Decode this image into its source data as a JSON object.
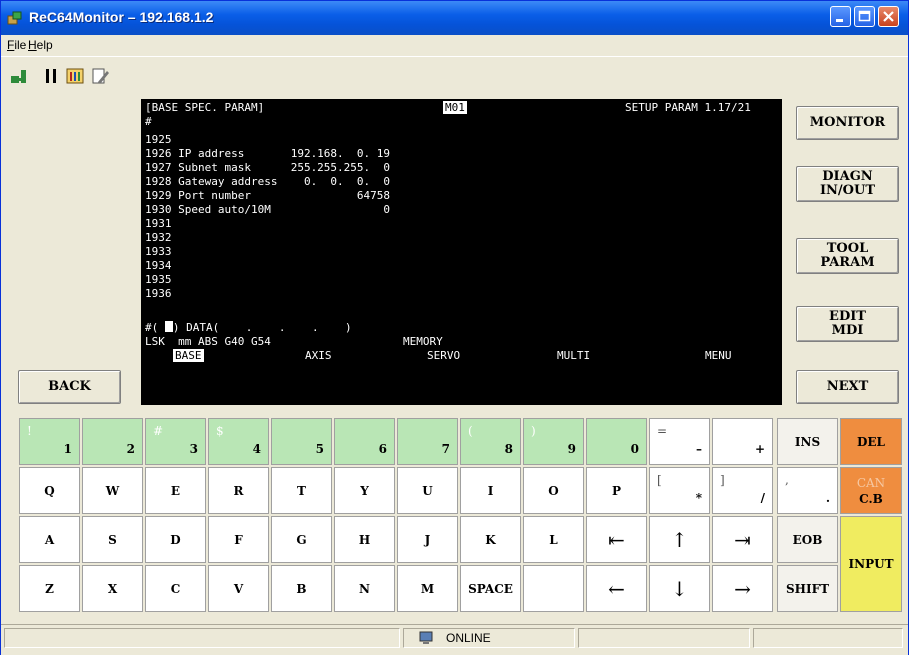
{
  "window": {
    "title": "ReC64Monitor  –  192.168.1.2"
  },
  "menu": {
    "file": "File",
    "help": "Help"
  },
  "toolbar": {
    "icons": [
      "connect-icon",
      "pause-icon",
      "settings-icon",
      "edit-icon"
    ]
  },
  "side_left": {
    "back": "BACK"
  },
  "side_right": {
    "monitor": "MONITOR",
    "diagn_1": "DIAGN",
    "diagn_2": "IN/OUT",
    "tool_1": "TOOL",
    "tool_2": "PARAM",
    "edit_1": "EDIT",
    "edit_2": "MDI",
    "next": "NEXT"
  },
  "screen": {
    "header_left": "[BASE SPEC. PARAM]",
    "header_tag": "M01",
    "header_right": "SETUP PARAM 1.17/21",
    "hash": "#",
    "lines": [
      "1925",
      "1926 IP address       192.168.  0. 19",
      "1927 Subnet mask      255.255.255.  0",
      "1928 Gateway address    0.  0.  0.  0",
      "1929 Port number                64758",
      "1930 Speed auto/10M                 0",
      "1931",
      "1932",
      "1933",
      "1934",
      "1935",
      "1936"
    ],
    "input_prefix": "#(",
    "input_suffix": ") DATA(    .    .    .    )",
    "status_left": "LSK  mm ABS G40 G54",
    "status_mid": "MEMORY",
    "menu_items": [
      "BASE",
      "AXIS",
      "SERVO",
      "MULTI",
      "MENU"
    ]
  },
  "keys": {
    "row1": [
      {
        "sub": "!",
        "main": "1"
      },
      {
        "sub": "",
        "main": "2"
      },
      {
        "sub": "#",
        "main": "3"
      },
      {
        "sub": "$",
        "main": "4"
      },
      {
        "sub": "",
        "main": "5"
      },
      {
        "sub": "",
        "main": "6"
      },
      {
        "sub": "",
        "main": "7"
      },
      {
        "sub": "(",
        "main": "8"
      },
      {
        "sub": ")",
        "main": "9"
      },
      {
        "sub": "",
        "main": "0"
      },
      {
        "sub": "=",
        "main": "–"
      },
      {
        "sub": "",
        "main": "+"
      }
    ],
    "ins": "INS",
    "del": "DEL",
    "row2": [
      "Q",
      "W",
      "E",
      "R",
      "T",
      "Y",
      "U",
      "I",
      "O",
      "P"
    ],
    "row2_sym": [
      {
        "sub": "[",
        "main": "*"
      },
      {
        "sub": "]",
        "main": "/"
      },
      {
        "sub": ",",
        "main": "."
      }
    ],
    "can": "CAN",
    "cb": "C.B",
    "row3": [
      "A",
      "S",
      "D",
      "F",
      "G",
      "H",
      "J",
      "K",
      "L"
    ],
    "row3_sym": [
      "⇤",
      "↑",
      "⇥"
    ],
    "eob": "EOB",
    "row4": [
      "Z",
      "X",
      "C",
      "V",
      "B",
      "N",
      "M",
      "SPACE",
      ""
    ],
    "row4_sym": [
      "←",
      "↓",
      "→"
    ],
    "shift": "SHIFT",
    "input": "INPUT"
  },
  "status": {
    "text": "ONLINE"
  }
}
